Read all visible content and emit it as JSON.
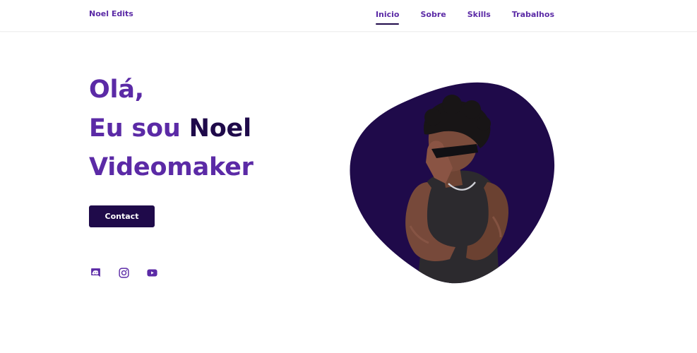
{
  "header": {
    "brand": "Noel Edits",
    "nav": [
      {
        "label": "Inicio",
        "active": true
      },
      {
        "label": "Sobre",
        "active": false
      },
      {
        "label": "Skills",
        "active": false
      },
      {
        "label": "Trabalhos",
        "active": false
      }
    ]
  },
  "hero": {
    "greeting": "Olá,",
    "intro": "Eu sou",
    "name": "Noel",
    "role": "Videomaker",
    "contact_label": "Contact"
  },
  "socials": [
    {
      "icon": "discord-icon"
    },
    {
      "icon": "instagram-icon"
    },
    {
      "icon": "youtube-icon"
    }
  ],
  "colors": {
    "primary": "#5b2aa6",
    "dark": "#1f0a4a",
    "background": "#ffffff"
  }
}
